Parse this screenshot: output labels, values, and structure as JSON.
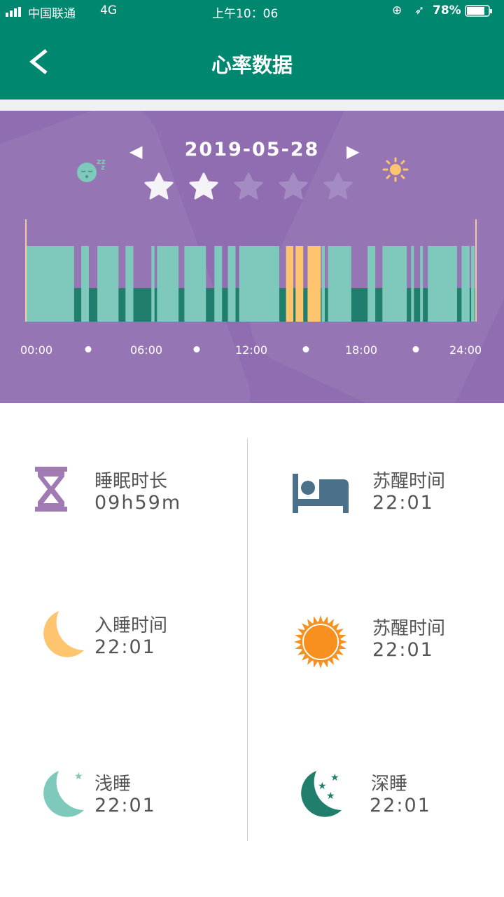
{
  "status_bar": {
    "carrier": "中国联通",
    "network": "4G",
    "time": "上午10：06",
    "battery": "78%"
  },
  "header": {
    "title": "心率数据",
    "back_icon": "chevron-left-icon"
  },
  "date_nav": {
    "date": "2019-05-28",
    "prev_icon": "triangle-left-icon",
    "next_icon": "triangle-right-icon"
  },
  "rating": {
    "value": 2,
    "max": 5
  },
  "colors": {
    "header": "#00876f",
    "panel": "#8f6db0",
    "light_sleep": "#7ec9bc",
    "deep_sleep": "#1f7f6c",
    "awake": "#ffc56e",
    "text": "#555555"
  },
  "chart_data": {
    "type": "bar",
    "x_range": [
      0,
      24
    ],
    "tick_labels": [
      "00:00",
      "06:00",
      "12:00",
      "18:00",
      "24:00"
    ],
    "levels": {
      "deep": "deep sleep",
      "light": "light sleep",
      "awake": "awake"
    },
    "deep_background": [
      2.57,
      24
    ],
    "segments": [
      {
        "start": 0,
        "end": 2.57,
        "type": "light"
      },
      {
        "start": 2.95,
        "end": 3.36,
        "type": "light"
      },
      {
        "start": 3.81,
        "end": 4.94,
        "type": "light"
      },
      {
        "start": 5.31,
        "end": 5.73,
        "type": "light"
      },
      {
        "start": 6.69,
        "end": 6.86,
        "type": "light"
      },
      {
        "start": 6.99,
        "end": 8.14,
        "type": "light"
      },
      {
        "start": 8.45,
        "end": 9.6,
        "type": "light"
      },
      {
        "start": 10.05,
        "end": 10.46,
        "type": "light"
      },
      {
        "start": 10.77,
        "end": 11.18,
        "type": "light"
      },
      {
        "start": 11.37,
        "end": 13.51,
        "type": "light"
      },
      {
        "start": 13.87,
        "end": 14.26,
        "type": "awake"
      },
      {
        "start": 14.38,
        "end": 14.79,
        "type": "awake"
      },
      {
        "start": 15.02,
        "end": 15.72,
        "type": "awake"
      },
      {
        "start": 15.77,
        "end": 15.94,
        "type": "light"
      },
      {
        "start": 16.11,
        "end": 17.35,
        "type": "light"
      },
      {
        "start": 18.22,
        "end": 18.63,
        "type": "light"
      },
      {
        "start": 19.01,
        "end": 20.31,
        "type": "light"
      },
      {
        "start": 20.54,
        "end": 20.69,
        "type": "light"
      },
      {
        "start": 21.02,
        "end": 21.17,
        "type": "light"
      },
      {
        "start": 21.43,
        "end": 22.99,
        "type": "light"
      },
      {
        "start": 23.23,
        "end": 23.66,
        "type": "light"
      },
      {
        "start": 23.74,
        "end": 23.93,
        "type": "light"
      }
    ]
  },
  "stats": [
    {
      "icon": "hourglass-icon",
      "label": "睡眠时长",
      "value": "09h59m"
    },
    {
      "icon": "bed-icon",
      "label": "苏醒时间",
      "value": "22:01"
    },
    {
      "icon": "moon-icon",
      "label": "入睡时间",
      "value": "22:01"
    },
    {
      "icon": "sun-icon",
      "label": "苏醒时间",
      "value": "22:01"
    },
    {
      "icon": "light-sleep-moon-icon",
      "label": "浅睡",
      "value": "22:01"
    },
    {
      "icon": "deep-sleep-moon-icon",
      "label": "深睡",
      "value": "22:01"
    }
  ]
}
